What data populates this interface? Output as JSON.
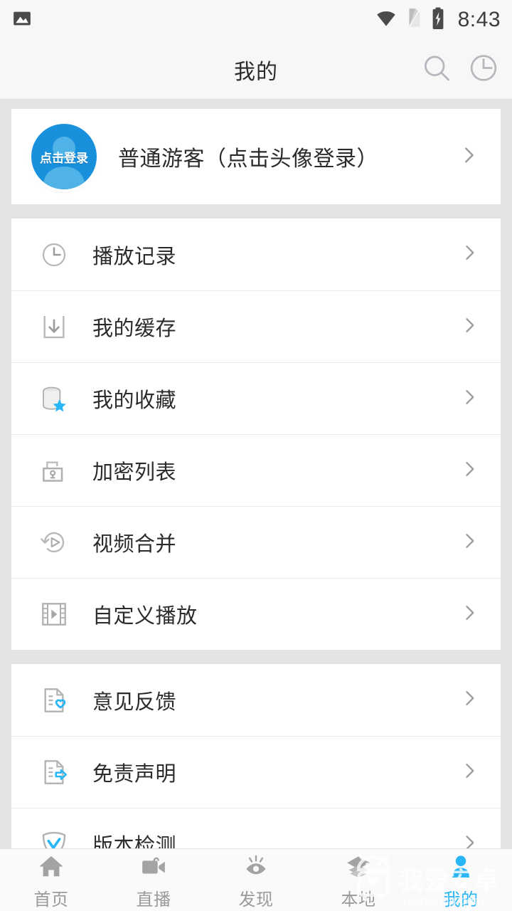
{
  "status_bar": {
    "time": "8:43",
    "left_icons": [
      "image-icon"
    ],
    "right_icons": [
      "wifi-icon",
      "sim-card-icon",
      "battery-charging-icon"
    ]
  },
  "header": {
    "title": "我的",
    "actions": [
      {
        "name": "search-icon",
        "label": "搜索"
      },
      {
        "name": "history-icon",
        "label": "历史"
      }
    ]
  },
  "profile": {
    "avatar_label": "点击登录",
    "name": "普通游客（点击头像登录）",
    "chevron": "chevron-right-icon",
    "avatar_color": "#1890dc"
  },
  "menu_group_1": [
    {
      "icon": "clock-icon",
      "label": "播放记录"
    },
    {
      "icon": "download-box-icon",
      "label": "我的缓存"
    },
    {
      "icon": "database-star-icon",
      "label": "我的收藏"
    },
    {
      "icon": "unlock-icon",
      "label": "加密列表"
    },
    {
      "icon": "video-merge-icon",
      "label": "视频合并"
    },
    {
      "icon": "film-play-icon",
      "label": "自定义播放"
    }
  ],
  "menu_group_2": [
    {
      "icon": "document-heart-icon",
      "label": "意见反馈"
    },
    {
      "icon": "document-arrow-icon",
      "label": "免责声明"
    },
    {
      "icon": "shield-check-icon",
      "label": "版本检测"
    }
  ],
  "bottom_nav": [
    {
      "icon": "home-icon",
      "label": "首页",
      "active": false
    },
    {
      "icon": "video-camera-icon",
      "label": "直播",
      "active": false
    },
    {
      "icon": "eye-icon",
      "label": "发现",
      "active": false
    },
    {
      "icon": "layers-icon",
      "label": "本地",
      "active": false
    },
    {
      "icon": "person-icon",
      "label": "我的",
      "active": true
    }
  ],
  "watermark": {
    "icon": "android-robot-icon",
    "title": "我爱安卓",
    "subtitle": "52android.com"
  },
  "colors": {
    "accent": "#29b6f6",
    "avatar_blue": "#1890dc",
    "background": "#e4e4e4",
    "card": "#ffffff",
    "header_bg": "#f7f7f7",
    "text_primary": "#2b2b2b",
    "text_muted": "#9a9a9a",
    "icon_gray": "#b0b0b0"
  }
}
